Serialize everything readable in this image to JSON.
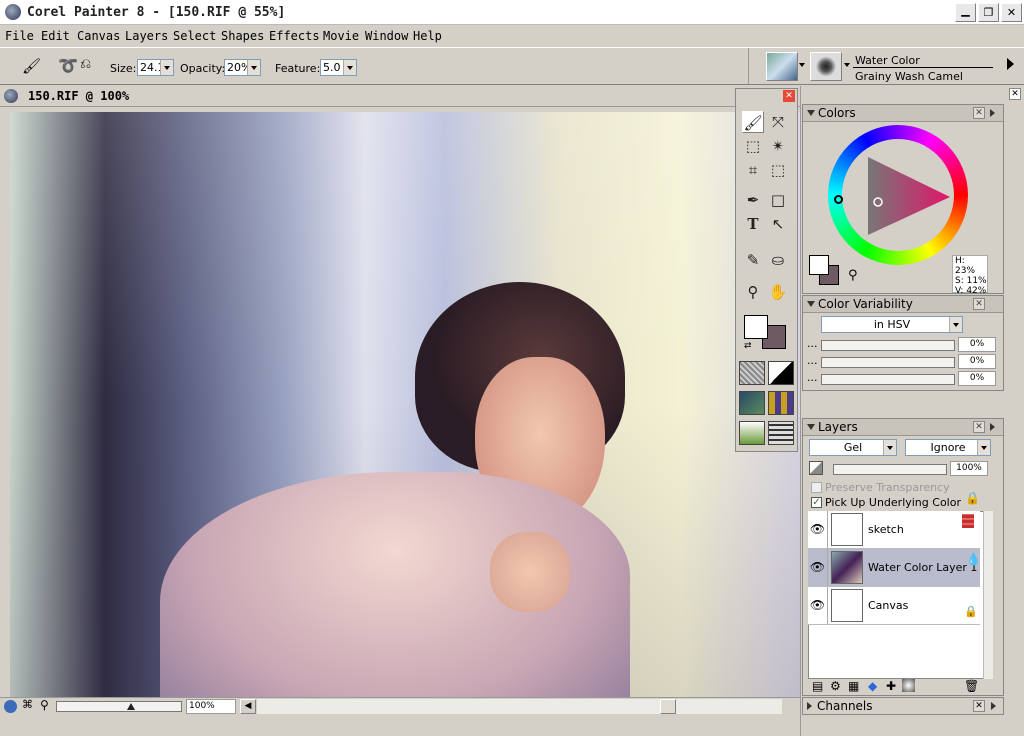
{
  "window": {
    "title": "Corel Painter 8 - [150.RIF @ 55%]"
  },
  "menu": [
    "File",
    "Edit",
    "Canvas",
    "Layers",
    "Select",
    "Shapes",
    "Effects",
    "Movie",
    "Window",
    "Help"
  ],
  "propertybar": {
    "size_label": "Size:",
    "size_value": "24.1",
    "opacity_label": "Opacity:",
    "opacity_value": "20%",
    "feature_label": "Feature:",
    "feature_value": "5.0"
  },
  "brush": {
    "category": "Water Color",
    "variant": "Grainy Wash Camel"
  },
  "document": {
    "title": "150.RIF @ 100%",
    "zoom": "100%"
  },
  "colors": {
    "title": "Colors",
    "h_readout": "H: 23%",
    "s_readout": "S: 11%",
    "v_readout": "V: 42%",
    "main_color": "#6e5a62",
    "secondary_color": "#ffffff"
  },
  "color_variability": {
    "title": "Color Variability",
    "mode": "in HSV",
    "rows": [
      {
        "dots": "...",
        "value": "0%"
      },
      {
        "dots": "...",
        "value": "0%"
      },
      {
        "dots": "...",
        "value": "0%"
      }
    ]
  },
  "layers": {
    "title": "Layers",
    "composite_method": "Gel",
    "composite_depth": "Ignore",
    "opacity": "100%",
    "preserve_transparency": "Preserve Transparency",
    "pick_up_underlying": "Pick Up Underlying Color",
    "items": [
      {
        "name": "sketch",
        "selected": false
      },
      {
        "name": "Water Color Layer 1",
        "selected": true
      },
      {
        "name": "Canvas",
        "selected": false
      }
    ]
  },
  "channels": {
    "title": "Channels"
  },
  "icons": [
    "app-icon",
    "brush-icon",
    "lasso-icon",
    "eye-icon",
    "lock-icon",
    "trash-icon",
    "eyedropper-icon",
    "hand-icon",
    "magnifier-icon",
    "paint-bucket-icon"
  ]
}
